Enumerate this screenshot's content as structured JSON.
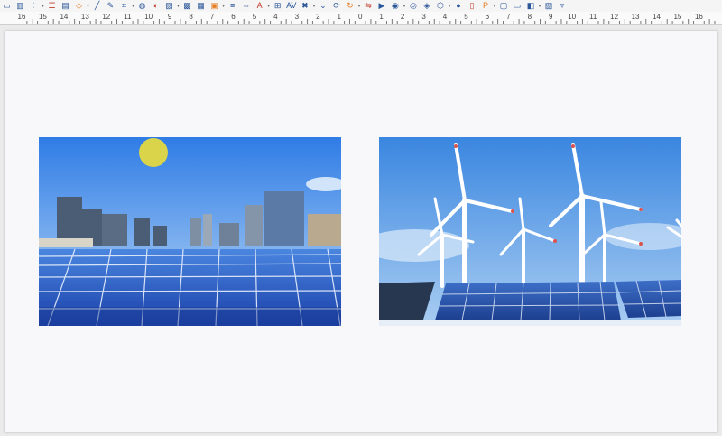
{
  "toolbar": {
    "icons": [
      "textbox-icon",
      "chart-icon",
      "align-icon",
      "distribute-icon",
      "arrange-icon",
      "shapes-icon",
      "line-icon",
      "draw-icon",
      "crop-icon",
      "filter-icon",
      "shadow-icon",
      "image-icon",
      "color-icon",
      "border-icon",
      "fill-icon",
      "line-style-icon",
      "spacing-icon",
      "fontwork-icon",
      "table-icon",
      "char-spacing-icon",
      "delete-icon",
      "chevron-icon",
      "transform-icon",
      "rotate-icon",
      "flip-icon",
      "media-icon",
      "sound-icon",
      "3d-icon",
      "effects-icon",
      "interaction-icon",
      "globe-icon",
      "page-icon",
      "hyperlink-icon",
      "frame-icon",
      "insert-icon",
      "slide-icon",
      "image2-icon",
      "more-icon"
    ]
  },
  "ruler": {
    "labels": [
      "16",
      "15",
      "14",
      "13",
      "12",
      "11",
      "10",
      "9",
      "8",
      "7",
      "6",
      "5",
      "4",
      "3",
      "2",
      "1",
      "0",
      "1",
      "2",
      "3",
      "4",
      "5",
      "6",
      "7",
      "8",
      "9",
      "10",
      "11",
      "12",
      "13",
      "14",
      "15",
      "16"
    ]
  },
  "slide": {
    "images": [
      {
        "name": "solar-panels-city-image"
      },
      {
        "name": "wind-turbines-solar-image"
      }
    ]
  },
  "colors": {
    "sky_blue": "#2f7ce6",
    "panel_blue": "#1f4fb8",
    "sun_yellow": "#d9d44a"
  }
}
